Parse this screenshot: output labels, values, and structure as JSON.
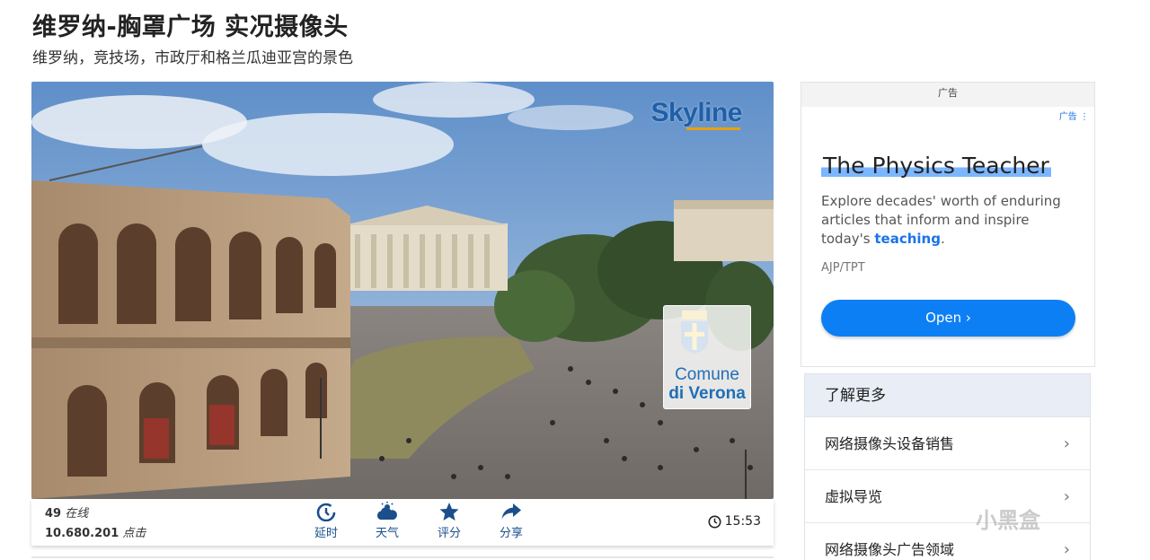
{
  "page": {
    "title": "维罗纳-胸罩广场 实况摄像头",
    "subtitle": "维罗纳，竞技场，市政厅和格兰瓜迪亚宫的景色"
  },
  "cam": {
    "logo": "Skyline",
    "badge_line1": "Comune",
    "badge_line2": "di Verona"
  },
  "toolbar": {
    "online_count": "49",
    "online_label": "在线",
    "clicks_count": "10.680.201",
    "clicks_label": "点击",
    "buttons": [
      {
        "label": "延时",
        "icon": "timelapse-icon"
      },
      {
        "label": "天气",
        "icon": "weather-icon"
      },
      {
        "label": "评分",
        "icon": "star-icon"
      },
      {
        "label": "分享",
        "icon": "share-icon"
      }
    ],
    "time": "15:53"
  },
  "ad": {
    "header": "广告",
    "tag": "广告 ⋮",
    "title": "The Physics Teacher",
    "desc_before": "Explore decades' worth of enduring articles that inform and inspire today's ",
    "desc_highlight": "teaching",
    "desc_after": ".",
    "source": "AJP/TPT",
    "button": "Open  ›"
  },
  "learn_more": {
    "title": "了解更多",
    "items": [
      {
        "label": "网络摄像头设备销售"
      },
      {
        "label": "虚拟导览"
      },
      {
        "label": "网络摄像头广告领域"
      }
    ]
  },
  "watermark": "小黑盒",
  "colors": {
    "accent": "#1a4f8c",
    "ad_button": "#0d7ff5",
    "link": "#1a73e8"
  }
}
